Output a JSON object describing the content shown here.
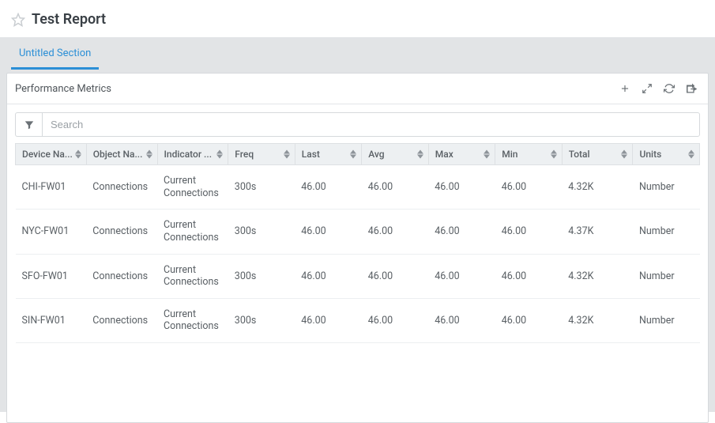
{
  "header": {
    "title": "Test Report"
  },
  "tabs": {
    "active_label": "Untitled Section"
  },
  "panel": {
    "title": "Performance Metrics",
    "toolbar_icons": [
      "plus-icon",
      "fullscreen-icon",
      "refresh-icon",
      "export-icon"
    ]
  },
  "search": {
    "placeholder": "Search"
  },
  "columns": {
    "device": "Device Na...",
    "object": "Object Na...",
    "indicator": "Indicator ...",
    "freq": "Freq",
    "last": "Last",
    "avg": "Avg",
    "max": "Max",
    "min": "Min",
    "total": "Total",
    "units": "Units"
  },
  "rows": [
    {
      "device": "CHI-FW01",
      "object": "Connections",
      "indicator": "Current Connections",
      "freq": "300s",
      "last": "46.00",
      "avg": "46.00",
      "max": "46.00",
      "min": "46.00",
      "total": "4.32K",
      "units": "Number"
    },
    {
      "device": "NYC-FW01",
      "object": "Connections",
      "indicator": "Current Connections",
      "freq": "300s",
      "last": "46.00",
      "avg": "46.00",
      "max": "46.00",
      "min": "46.00",
      "total": "4.37K",
      "units": "Number"
    },
    {
      "device": "SFO-FW01",
      "object": "Connections",
      "indicator": "Current Connections",
      "freq": "300s",
      "last": "46.00",
      "avg": "46.00",
      "max": "46.00",
      "min": "46.00",
      "total": "4.32K",
      "units": "Number"
    },
    {
      "device": "SIN-FW01",
      "object": "Connections",
      "indicator": "Current Connections",
      "freq": "300s",
      "last": "46.00",
      "avg": "46.00",
      "max": "46.00",
      "min": "46.00",
      "total": "4.32K",
      "units": "Number"
    }
  ]
}
